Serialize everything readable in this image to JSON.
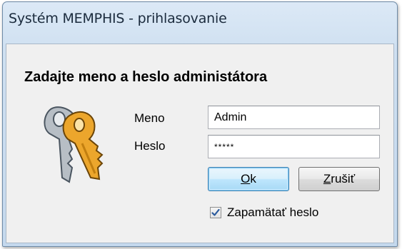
{
  "window": {
    "title": "Systém MEMPHIS - prihlasovanie"
  },
  "dialog": {
    "heading": "Zadajte meno a heslo administátora",
    "username_label": "Meno",
    "username_value": "Admin",
    "password_label": "Heslo",
    "password_value": "*****",
    "ok_button": {
      "mnemonic": "O",
      "rest": "k"
    },
    "cancel_button": {
      "mnemonic": "Z",
      "rest": "rušiť"
    },
    "remember_label": "Zapamätať heslo",
    "remember_checked": true
  },
  "icons": {
    "keys": "keys-icon",
    "check": "checkmark-icon"
  },
  "colors": {
    "accent_border": "#3c7fb1",
    "key_gold": "#e8a52a",
    "key_silver": "#9aa3ab"
  }
}
